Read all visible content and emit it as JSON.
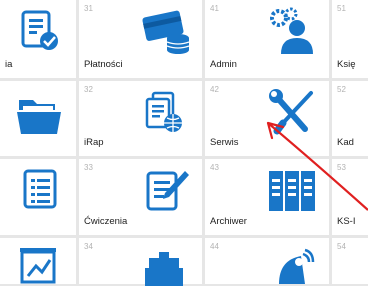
{
  "tiles": {
    "r1c1": {
      "label": "ia"
    },
    "r1c2": {
      "num": "31",
      "label": "Płatności"
    },
    "r1c3": {
      "num": "41",
      "label": "Admin"
    },
    "r1c4": {
      "num": "51",
      "label": "Księ"
    },
    "r2c1": {
      "label": ""
    },
    "r2c2": {
      "num": "32",
      "label": "iRap"
    },
    "r2c3": {
      "num": "42",
      "label": "Serwis"
    },
    "r2c4": {
      "num": "52",
      "label": "Kad"
    },
    "r3c1": {
      "label": ""
    },
    "r3c2": {
      "num": "33",
      "label": "Ćwiczenia"
    },
    "r3c3": {
      "num": "43",
      "label": "Archiwer"
    },
    "r3c4": {
      "num": "53",
      "label": "KS-I"
    },
    "r4c1": {
      "label": ""
    },
    "r4c2": {
      "num": "34",
      "label": ""
    },
    "r4c3": {
      "num": "44",
      "label": ""
    },
    "r4c4": {
      "num": "54",
      "label": ""
    }
  },
  "colors": {
    "accent": "#1976c8",
    "annotation": "#e02020",
    "tile_bg": "#ffffff",
    "grid_bg": "#e6e6e6"
  }
}
